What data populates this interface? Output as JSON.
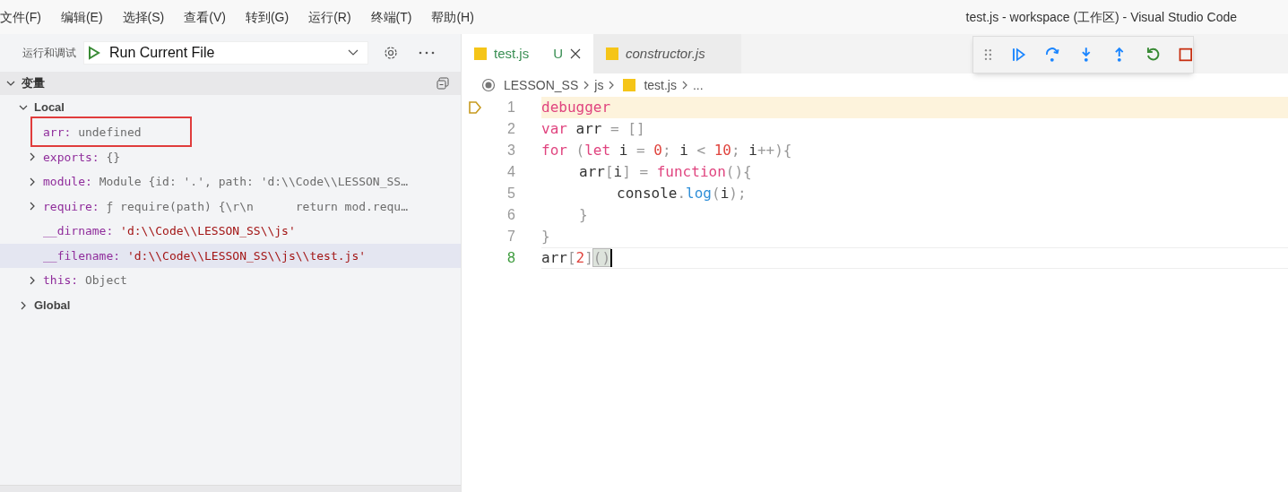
{
  "menu": [
    "文件(F)",
    "编辑(E)",
    "选择(S)",
    "查看(V)",
    "转到(G)",
    "运行(R)",
    "终端(T)",
    "帮助(H)"
  ],
  "window": {
    "title": "test.js - workspace (工作区) - Visual Studio Code"
  },
  "run_panel": {
    "label": "运行和调试",
    "configuration": "Run Current File"
  },
  "variables": {
    "title": "变量",
    "expanded": true,
    "scopes": [
      {
        "name": "Local",
        "expanded": true,
        "children": [
          {
            "name": "arr:",
            "value": "undefined",
            "kind": "plain",
            "expandable": false,
            "outlined": true,
            "hovered": false
          },
          {
            "name": "exports:",
            "value": "{}",
            "kind": "plain",
            "expandable": true,
            "outlined": false,
            "hovered": false
          },
          {
            "name": "module:",
            "value": "Module {id: '.', path: 'd:\\\\Code\\\\LESSON_SS…",
            "kind": "plain",
            "expandable": true,
            "outlined": false,
            "hovered": false
          },
          {
            "name": "require:",
            "value": "ƒ require(path) {\\r\\n      return mod.requ…",
            "kind": "plain",
            "expandable": true,
            "outlined": false,
            "hovered": false
          },
          {
            "name": "__dirname:",
            "value": "'d:\\\\Code\\\\LESSON_SS\\\\js'",
            "kind": "string",
            "expandable": false,
            "outlined": false,
            "hovered": false
          },
          {
            "name": "__filename:",
            "value": "'d:\\\\Code\\\\LESSON_SS\\\\js\\\\test.js'",
            "kind": "string",
            "expandable": false,
            "outlined": false,
            "hovered": true
          },
          {
            "name": "this:",
            "value": "Object",
            "kind": "plain",
            "expandable": true,
            "outlined": false,
            "hovered": false
          }
        ]
      },
      {
        "name": "Global",
        "expanded": false
      }
    ]
  },
  "tabs": [
    {
      "label": "test.js",
      "selected": true,
      "badge": "U",
      "italic": false
    },
    {
      "label": "constructor.js",
      "selected": false,
      "italic": true
    }
  ],
  "breadcrumb": [
    "LESSON_SS",
    "js",
    "test.js",
    "..."
  ],
  "editor": {
    "lines": [
      {
        "number": "1",
        "paused": true,
        "cursor": false,
        "tokens": [
          {
            "kind": "keyword",
            "text": "debugger"
          }
        ]
      },
      {
        "number": "2",
        "paused": false,
        "cursor": false,
        "tokens": [
          {
            "kind": "keyword",
            "text": "var"
          },
          {
            "kind": "identifier",
            "text": " arr "
          },
          {
            "kind": "punctuation",
            "text": "= []"
          }
        ]
      },
      {
        "number": "3",
        "paused": false,
        "cursor": false,
        "tokens": [
          {
            "kind": "keyword",
            "text": "for"
          },
          {
            "kind": "punctuation",
            "text": " ("
          },
          {
            "kind": "keyword",
            "text": "let"
          },
          {
            "kind": "identifier",
            "text": " i "
          },
          {
            "kind": "punctuation",
            "text": "= "
          },
          {
            "kind": "number",
            "text": "0"
          },
          {
            "kind": "punctuation",
            "text": ";"
          },
          {
            "kind": "identifier",
            "text": " i "
          },
          {
            "kind": "punctuation",
            "text": "< "
          },
          {
            "kind": "number",
            "text": "10"
          },
          {
            "kind": "punctuation",
            "text": ";"
          },
          {
            "kind": "identifier",
            "text": " i"
          },
          {
            "kind": "punctuation",
            "text": "++){"
          }
        ],
        "children": [
          {
            "number": "4",
            "paused": false,
            "cursor": false,
            "tokens": [
              {
                "kind": "identifier",
                "text": "arr"
              },
              {
                "kind": "punctuation",
                "text": "["
              },
              {
                "kind": "identifier",
                "text": "i"
              },
              {
                "kind": "punctuation",
                "text": "] = "
              },
              {
                "kind": "keyword",
                "text": "function"
              },
              {
                "kind": "punctuation",
                "text": "(){"
              }
            ],
            "children": [
              {
                "number": "5",
                "paused": false,
                "cursor": false,
                "tokens": [
                  {
                    "kind": "identifier",
                    "text": "console"
                  },
                  {
                    "kind": "punctuation",
                    "text": "."
                  },
                  {
                    "kind": "function",
                    "text": "log"
                  },
                  {
                    "kind": "punctuation",
                    "text": "("
                  },
                  {
                    "kind": "identifier",
                    "text": "i"
                  },
                  {
                    "kind": "punctuation",
                    "text": ");"
                  }
                ]
              }
            ]
          },
          {
            "number": "6",
            "paused": false,
            "cursor": false,
            "tokens": [
              {
                "kind": "punctuation",
                "text": "}"
              }
            ]
          }
        ]
      },
      {
        "number": "7",
        "paused": false,
        "cursor": false,
        "tokens": [
          {
            "kind": "punctuation",
            "text": "}"
          }
        ]
      },
      {
        "number": "8",
        "paused": false,
        "cursor": true,
        "tokens": [
          {
            "kind": "identifier",
            "text": "arr"
          },
          {
            "kind": "punctuation",
            "text": "["
          },
          {
            "kind": "number",
            "text": "2"
          },
          {
            "kind": "punctuation",
            "text": "]"
          },
          {
            "kind": "matched-bracket",
            "text": "()"
          }
        ]
      }
    ]
  }
}
